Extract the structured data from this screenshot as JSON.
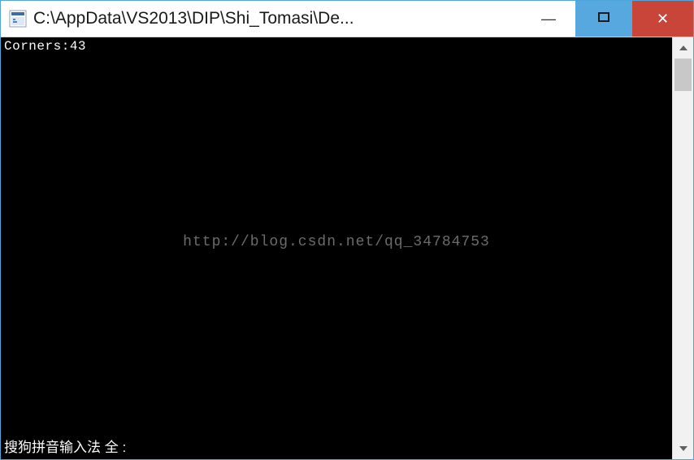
{
  "titlebar": {
    "title": "C:\\AppData\\VS2013\\DIP\\Shi_Tomasi\\De..."
  },
  "console": {
    "output_label": "Corners:",
    "output_value": "43",
    "watermark": "http://blog.csdn.net/qq_34784753",
    "ime_status": "搜狗拼音输入法 全 :"
  },
  "icons": {
    "minimize": "—",
    "close": "✕"
  }
}
